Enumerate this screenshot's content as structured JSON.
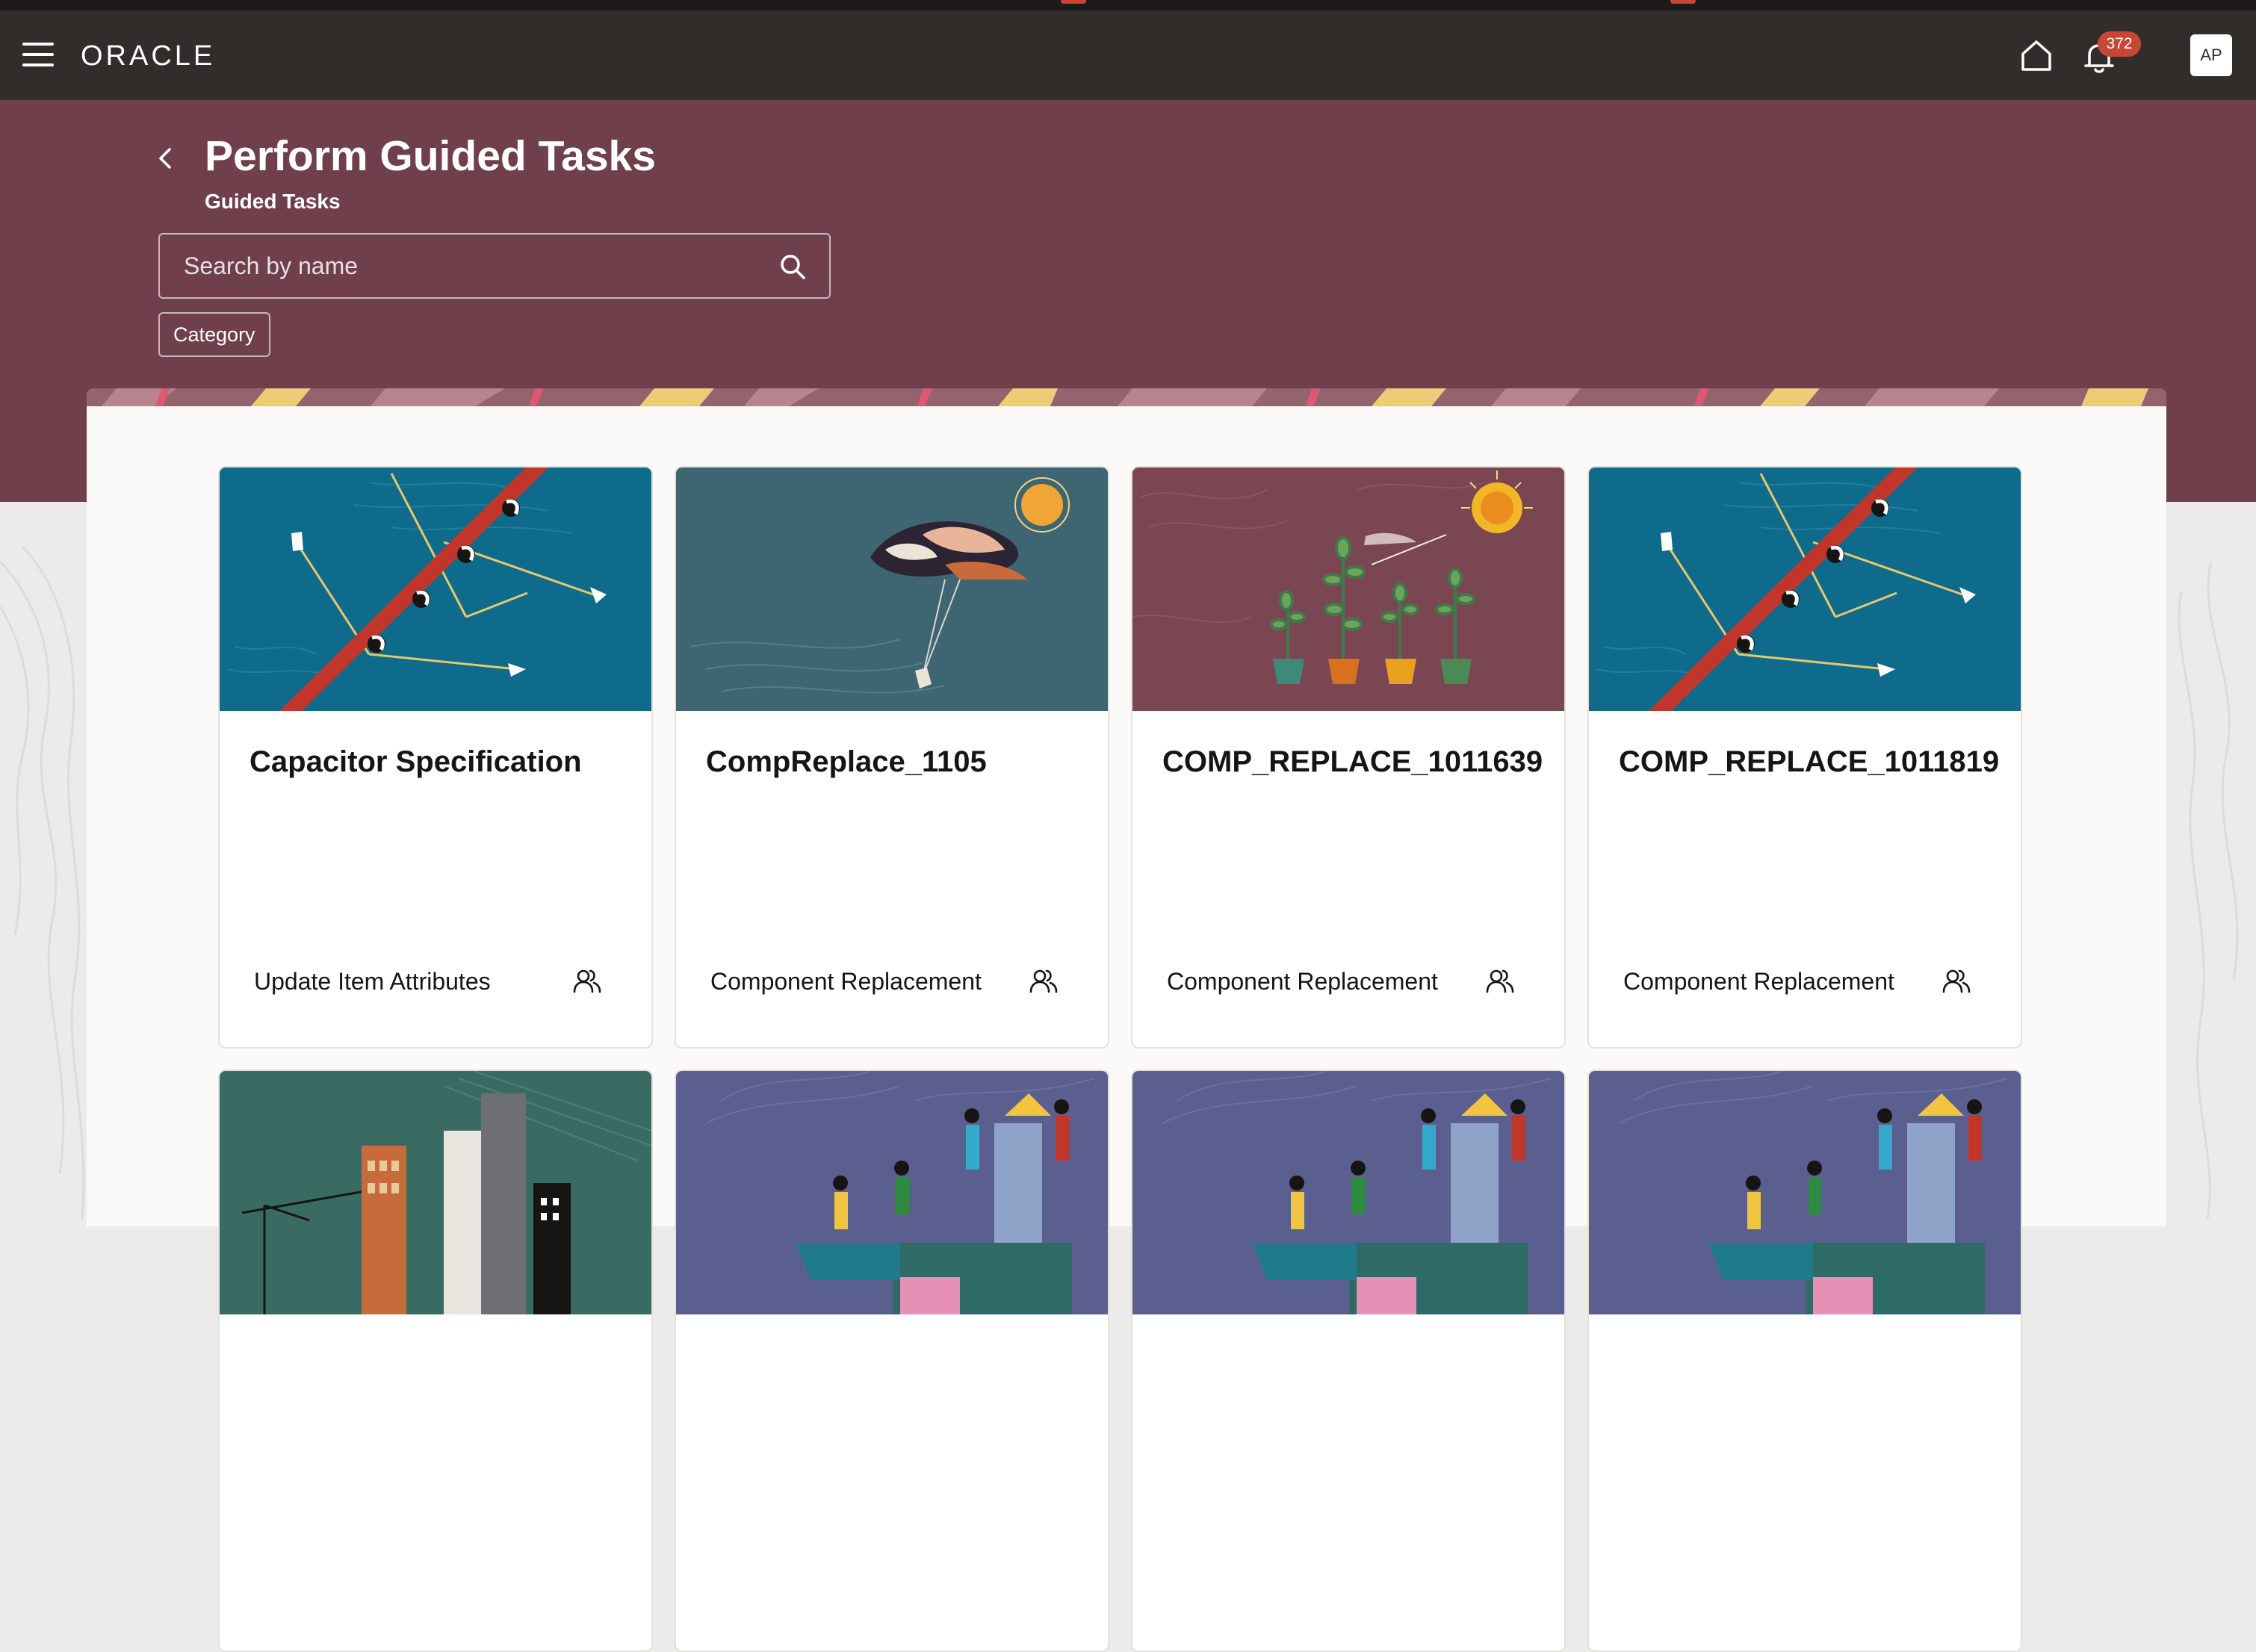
{
  "app": {
    "brand": "ORACLE",
    "notification_count": "372",
    "user_initials": "AP"
  },
  "page": {
    "title": "Perform Guided Tasks",
    "subtitle": "Guided Tasks"
  },
  "search": {
    "placeholder": "Search by name",
    "value": ""
  },
  "filters": {
    "category_label": "Category"
  },
  "cards": [
    {
      "title": "Capacitor Specification",
      "category": "Update Item Attributes",
      "art": "rowing"
    },
    {
      "title": "CompReplace_1105",
      "category": "Component Replacement",
      "art": "sky-figures"
    },
    {
      "title": "COMP_REPLACE_1011639",
      "category": "Component Replacement",
      "art": "plants-sun"
    },
    {
      "title": "COMP_REPLACE_1011819",
      "category": "Component Replacement",
      "art": "rowing"
    },
    {
      "title": "",
      "category": "",
      "art": "city"
    },
    {
      "title": "",
      "category": "",
      "art": "people-building"
    },
    {
      "title": "",
      "category": "",
      "art": "people-building"
    },
    {
      "title": "",
      "category": "",
      "art": "people-building"
    }
  ],
  "colors": {
    "header": "#312d2a",
    "band": "#6f404b",
    "badge": "#c74634",
    "accent_red": "#c74634"
  }
}
